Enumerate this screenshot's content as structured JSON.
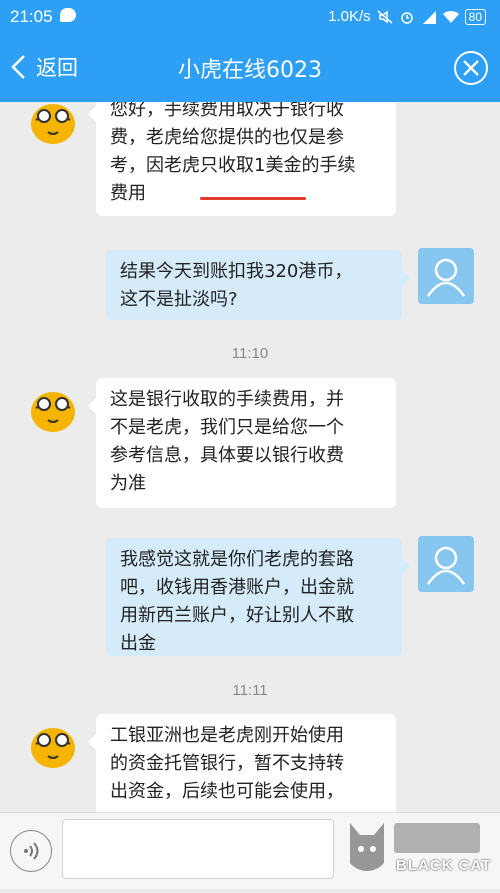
{
  "status_bar": {
    "time": "21:05",
    "net_speed": "1.0K/s",
    "battery": "80"
  },
  "header": {
    "back_label": "返回",
    "title": "小虎在线6023"
  },
  "messages": [
    {
      "sender": "agent",
      "lines": [
        "您好，手续费用取决于银行收",
        "费，老虎给您提供的也仅是参",
        "考，因老虎只收取1美金的手续",
        "费用"
      ]
    },
    {
      "sender": "user",
      "lines": [
        "结果今天到账扣我320港币，",
        "这不是扯淡吗?"
      ]
    },
    {
      "timestamp": "11:10"
    },
    {
      "sender": "agent",
      "lines": [
        "这是银行收取的手续费用，并",
        "不是老虎，我们只是给您一个",
        "参考信息，具体要以银行收费",
        "为准"
      ]
    },
    {
      "sender": "user",
      "lines": [
        "我感觉这就是你们老虎的套路",
        "吧，收钱用香港账户，出金就",
        "用新西兰账户，好让别人不敢",
        "出金"
      ]
    },
    {
      "timestamp": "11:11"
    },
    {
      "sender": "agent",
      "lines": [
        "工银亚洲也是老虎刚开始使用",
        "的资金托管银行，暂不支持转",
        "出资金，后续也可能会使用，"
      ]
    }
  ],
  "watermark": "BLACK CAT",
  "colors": {
    "header_bg": "#2d9ff5",
    "user_bubble": "#d6ebf9",
    "agent_bubble": "#ffffff",
    "underline": "#e23a2b"
  }
}
